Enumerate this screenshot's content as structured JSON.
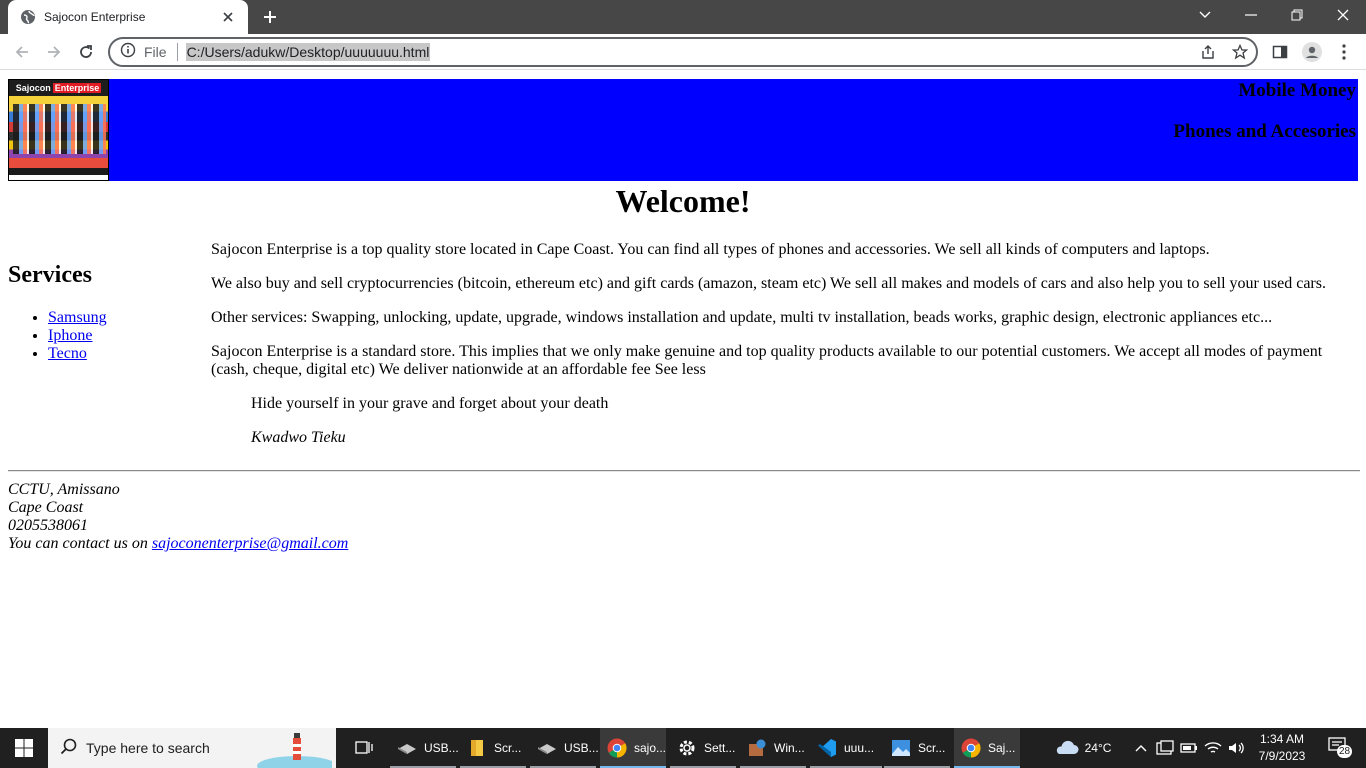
{
  "browser": {
    "tab_title": "Sajocon Enterprise",
    "omnibox_scheme_label": "File",
    "url": "C:/Users/adukw/Desktop/uuuuuuu.html"
  },
  "banner": {
    "logo_text_1": "Sajocon",
    "logo_text_2": "Enterprise",
    "right_line_1": "Mobile Money",
    "right_line_2": "Phones and Accesories"
  },
  "heading": "Welcome!",
  "sidebar": {
    "title": "Services",
    "links": [
      "Samsung",
      "Iphone",
      "Tecno"
    ]
  },
  "main": {
    "paragraphs": [
      "Sajocon Enterprise is a top quality store located in Cape Coast. You can find all types of phones and accessories. We sell all kinds of computers and laptops.",
      "We also buy and sell cryptocurrencies (bitcoin, ethereum etc) and gift cards (amazon, steam etc) We sell all makes and models of cars and also help you to sell your used cars.",
      "Other services: Swapping, unlocking, update, upgrade, windows installation and update, multi tv installation, beads works, graphic design, electronic appliances etc...",
      "Sajocon Enterprise is a standard store. This implies that we only make genuine and top quality products available to our potential customers. We accept all modes of payment (cash, cheque, digital etc) We deliver nationwide at an affordable fee See less"
    ],
    "quote": "Hide yourself in your grave and forget about your death",
    "quote_author": "Kwadwo Tieku"
  },
  "footer": {
    "line_1": "CCTU, Amissano",
    "line_2": "Cape Coast",
    "line_3": "0205538061",
    "contact_prefix": "You can contact us on",
    "email": "sajoconenterprise@gmail.com"
  },
  "taskbar": {
    "search_placeholder": "Type here to search",
    "apps": [
      {
        "label": "USB...",
        "icon": "usb-drive-icon"
      },
      {
        "label": "Scr...",
        "icon": "folder-icon"
      },
      {
        "label": "USB...",
        "icon": "usb-drive-icon"
      },
      {
        "label": "sajo...",
        "icon": "chrome-icon"
      },
      {
        "label": "Sett...",
        "icon": "gear-icon"
      },
      {
        "label": "Win...",
        "icon": "windows-app-icon"
      },
      {
        "label": "uuu...",
        "icon": "vscode-icon"
      },
      {
        "label": "Scr...",
        "icon": "photos-icon"
      },
      {
        "label": "Saj...",
        "icon": "chrome-icon"
      }
    ],
    "weather": "24°C",
    "time": "1:34 AM",
    "date": "7/9/2023",
    "notification_count": "28"
  },
  "colors": {
    "banner_bg": "#0000ff",
    "link": "#0000ee",
    "taskbar_bg": "#202020",
    "tabstrip_bg": "#474747"
  }
}
